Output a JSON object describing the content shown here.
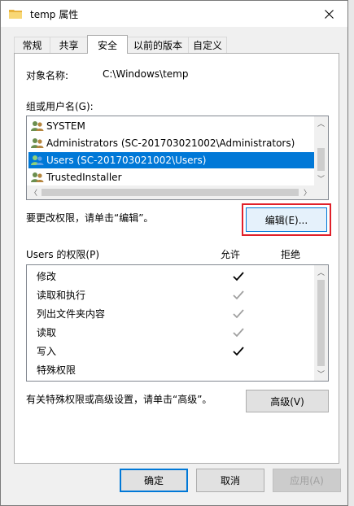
{
  "window": {
    "title": "temp 属性",
    "close_glyph": "✕"
  },
  "tabs": [
    {
      "label": "常规",
      "active": false
    },
    {
      "label": "共享",
      "active": false
    },
    {
      "label": "安全",
      "active": true
    },
    {
      "label": "以前的版本",
      "active": false
    },
    {
      "label": "自定义",
      "active": false
    }
  ],
  "security": {
    "object_name_label": "对象名称:",
    "object_name_value": "C:\\Windows\\temp",
    "groups_label": "组或用户名(G):",
    "groups": [
      {
        "name": "SYSTEM",
        "selected": false
      },
      {
        "name": "Administrators (SC-201703021002\\Administrators)",
        "selected": false
      },
      {
        "name": "Users (SC-201703021002\\Users)",
        "selected": true
      },
      {
        "name": "TrustedInstaller",
        "selected": false
      }
    ],
    "edit_hint": "要更改权限，请单击“编辑”。",
    "edit_button": "编辑(E)...",
    "permissions_label": "Users 的权限(P)",
    "allow_header": "允许",
    "deny_header": "拒绝",
    "permissions": [
      {
        "name": "修改",
        "allow": "checked"
      },
      {
        "name": "读取和执行",
        "allow": "inherited"
      },
      {
        "name": "列出文件夹内容",
        "allow": "inherited"
      },
      {
        "name": "读取",
        "allow": "inherited"
      },
      {
        "name": "写入",
        "allow": "checked"
      },
      {
        "name": "特殊权限",
        "allow": "none"
      }
    ],
    "advanced_hint": "有关特殊权限或高级设置，请单击“高级”。",
    "advanced_button": "高级(V)"
  },
  "footer": {
    "ok": "确定",
    "cancel": "取消",
    "apply": "应用(A)"
  },
  "colors": {
    "selection": "#0078d7",
    "highlight": "#e0202a",
    "check_active": "#000000",
    "check_inherited": "#a0a0a0"
  }
}
